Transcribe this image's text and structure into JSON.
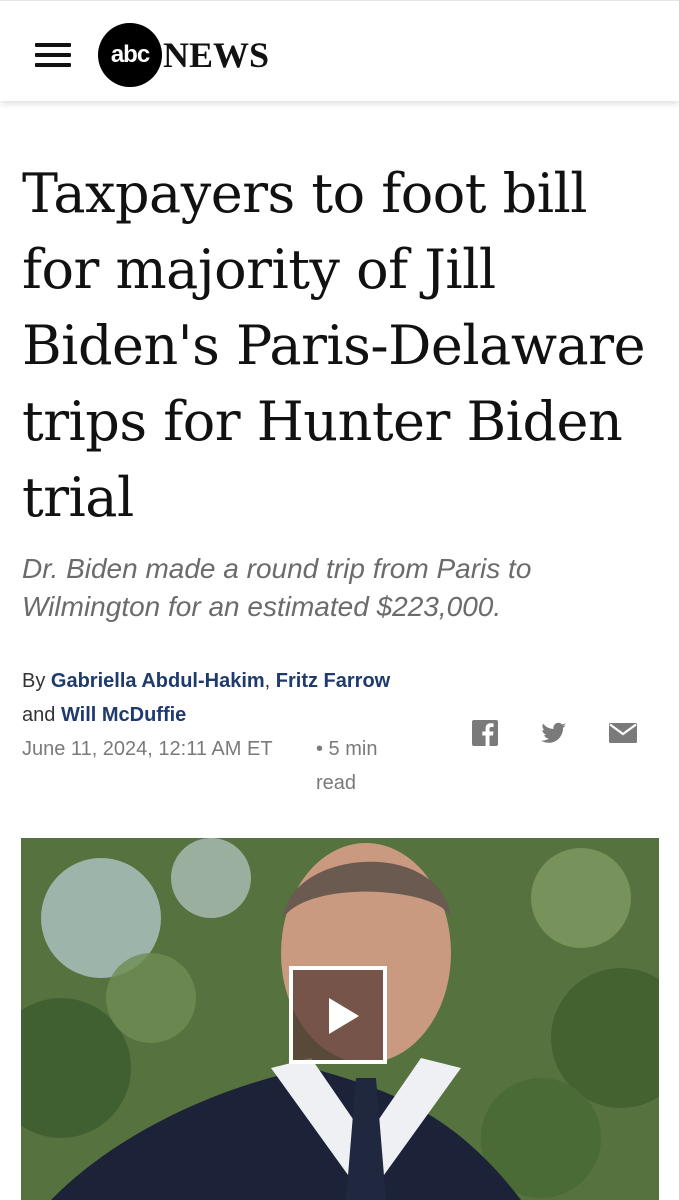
{
  "header": {
    "logo_circle_text": "abc",
    "logo_text": "NEWS",
    "menu_icon": "hamburger-menu-icon"
  },
  "article": {
    "headline": "Taxpayers to foot bill for majority of Jill Biden's Paris-Delaware trips for Hunter Biden trial",
    "subheadline": "Dr. Biden made a round trip from Paris to Wilmington for an estimated $223,000.",
    "byline": {
      "prefix": "By",
      "author1": "Gabriella Abdul-Hakim",
      "sep1": ",",
      "author2": "Fritz Farrow",
      "and": "and",
      "author3": "Will McDuffie"
    },
    "date": "June 11, 2024, 12:11 AM ET",
    "read_time": "• 5 min read"
  },
  "share": {
    "facebook_icon": "facebook-icon",
    "twitter_icon": "twitter-icon",
    "email_icon": "email-icon"
  },
  "media": {
    "play_icon": "play-icon"
  }
}
